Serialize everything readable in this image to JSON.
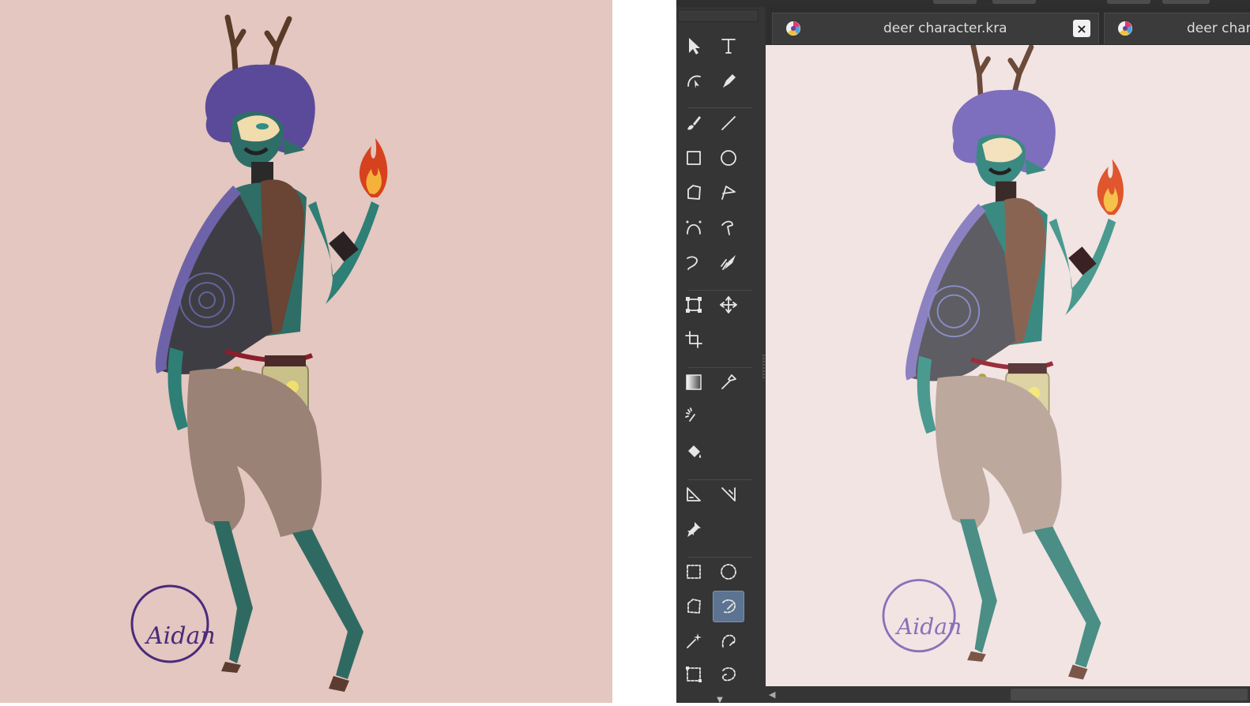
{
  "app": {
    "tabs": [
      {
        "title": "deer character.kra",
        "close_icon": "×"
      },
      {
        "title": "deer charac"
      }
    ]
  },
  "toolbox": {
    "active_tool": "similar-color-selection-tool",
    "tools": [
      "select-shapes-tool",
      "text-tool",
      "edit-shapes-tool",
      "calligraphy-tool",
      "freehand-brush-tool",
      "line-tool",
      "rectangle-tool",
      "ellipse-tool",
      "polygon-tool",
      "polyline-tool",
      "bezier-curve-tool",
      "freehand-path-tool",
      "dynamic-brush-tool",
      "multibrush-tool",
      "transform-tool",
      "move-tool",
      "crop-tool",
      "gradient-tool",
      "color-sampler-tool",
      "smart-patch-tool",
      "fill-tool",
      "assistant-tool",
      "measure-tool",
      "reference-images-tool",
      "rectangular-selection-tool",
      "elliptical-selection-tool",
      "polygonal-selection-tool",
      "freehand-selection-tool",
      "contiguous-selection-tool",
      "similar-color-selection-tool",
      "bezier-selection-tool",
      "magnetic-selection-tool"
    ]
  },
  "colors": {
    "left_background": "#e3c7c0",
    "canvas_background": "#f1e4e3",
    "app_dark": "#353535",
    "active_tool": "#5c7491",
    "signature": "#4a2a7a"
  },
  "signature": {
    "text": "Aidan"
  }
}
